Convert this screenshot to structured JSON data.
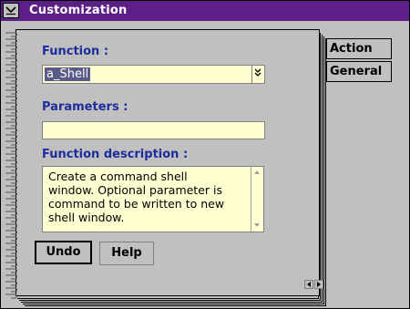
{
  "window": {
    "title": "Customization"
  },
  "function_field": {
    "label": "Function :",
    "value": "a_Shell"
  },
  "parameters_field": {
    "label": "Parameters :",
    "value": ""
  },
  "description_field": {
    "label": "Function description :",
    "text": "Create a command shell\nwindow.  Optional parameter is\ncommand to be written to new\nshell window."
  },
  "buttons": {
    "undo": "Undo",
    "help": "Help"
  },
  "tabs": [
    {
      "label": "Action"
    },
    {
      "label": "General"
    }
  ],
  "colors": {
    "titlebar": "#5d1e86",
    "label_text": "#1c2c9a",
    "field_bg": "#ffffd2"
  },
  "icons": {
    "system_menu": "chevron-down-icon",
    "combo_arrow": "double-chevron-down-icon"
  }
}
